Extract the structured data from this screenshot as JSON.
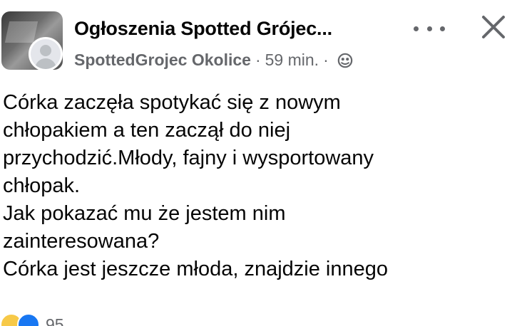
{
  "header": {
    "group_name": "Ogłoszenia Spotted Grójec...",
    "author": "SpottedGrojec Okolice",
    "separator": "·",
    "timestamp": "59 min.",
    "separator2": "·",
    "privacy_icon": "globe-icon",
    "more_icon": "more-dots-icon",
    "close_icon": "close-icon"
  },
  "post": {
    "lines": [
      "Córka zaczęła spotykać się z nowym",
      "chłopakiem a ten zaczął do niej",
      "przychodzić.Młody, fajny i wysportowany",
      "chłopak.",
      "Jak pokazać mu że jestem nim",
      "zainteresowana?",
      "Córka jest jeszcze młoda, znajdzie innego"
    ]
  },
  "footer": {
    "reaction_count": "95",
    "reaction_icons": [
      "haha-icon",
      "like-icon"
    ]
  },
  "colors": {
    "text": "#050505",
    "secondary": "#65676b",
    "like": "#1877f2",
    "haha": "#f7c948"
  }
}
